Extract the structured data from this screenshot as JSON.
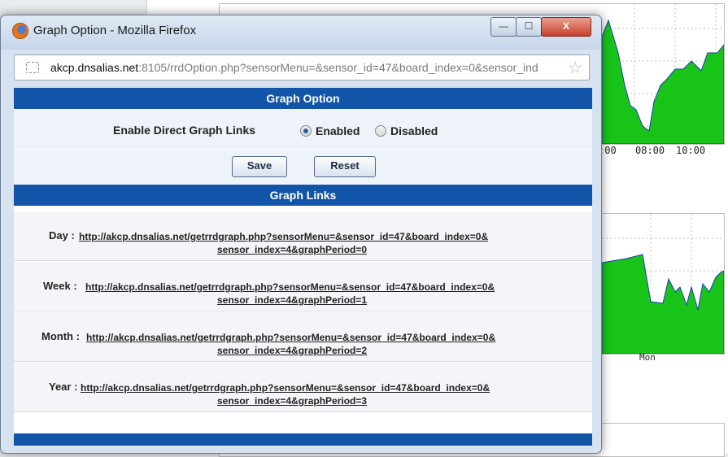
{
  "window": {
    "title": "Graph Option - Mozilla Firefox",
    "minimize_glyph": "—",
    "maximize_glyph": "☐",
    "close_glyph": "X"
  },
  "address_bar": {
    "domain": "akcp.dnsalias.net",
    "rest": ":8105/rrdOption.php?sensorMenu=&sensor_id=47&board_index=0&sensor_ind",
    "star_glyph": "☆"
  },
  "graph_option": {
    "header": "Graph Option",
    "label": "Enable Direct Graph Links",
    "options": [
      {
        "label": "Enabled",
        "checked": true
      },
      {
        "label": "Disabled",
        "checked": false
      }
    ],
    "save_label": "Save",
    "reset_label": "Reset"
  },
  "graph_links": {
    "header": "Graph Links",
    "items": [
      {
        "label": "Day :",
        "line1": "http://akcp.dnsalias.net/getrrdgraph.php?sensorMenu=&sensor_id=47&board_index=0&",
        "line2": "sensor_index=4&graphPeriod=0"
      },
      {
        "label": "Week :",
        "line1": "http://akcp.dnsalias.net/getrrdgraph.php?sensorMenu=&sensor_id=47&board_index=0&",
        "line2": "sensor_index=4&graphPeriod=1"
      },
      {
        "label": "Month :",
        "line1": "http://akcp.dnsalias.net/getrrdgraph.php?sensorMenu=&sensor_id=47&board_index=0&",
        "line2": "sensor_index=4&graphPeriod=2"
      },
      {
        "label": "Year :",
        "line1": "http://akcp.dnsalias.net/getrrdgraph.php?sensorMenu=&sensor_id=47&board_index=0&",
        "line2": "sensor_index=4&graphPeriod=3"
      }
    ]
  },
  "background": {
    "ticks_graph1": [
      ":00",
      "08:00",
      "10:00"
    ],
    "ticks_graph2": [
      "Mon"
    ]
  },
  "colors": {
    "header_blue": "#1255a8",
    "graph_fill": "#19c419"
  }
}
